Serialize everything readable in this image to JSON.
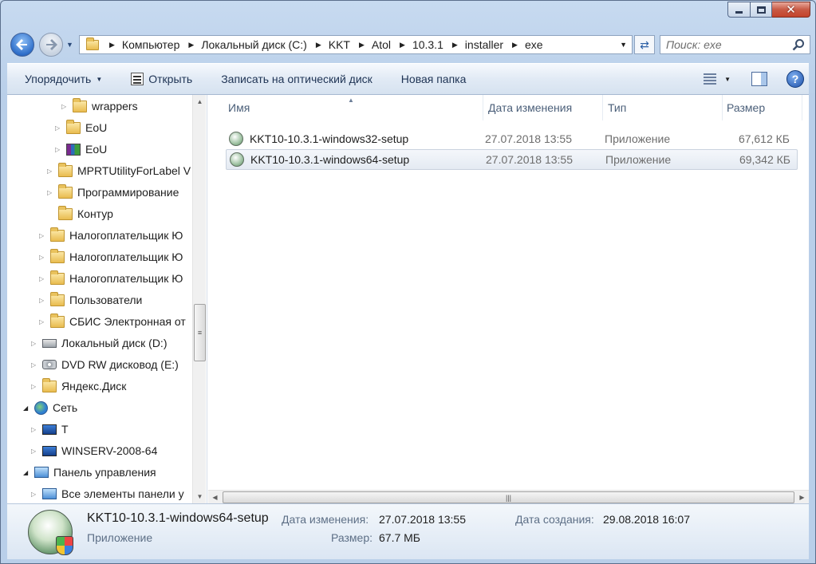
{
  "window": {
    "close_glyph": "✕"
  },
  "nav": {
    "breadcrumb": [
      "Компьютер",
      "Локальный диск (C:)",
      "KKT",
      "Atol",
      "10.3.1",
      "installer",
      "exe"
    ],
    "search_placeholder": "Поиск: exe",
    "refresh_glyph": "⇄"
  },
  "toolbar": {
    "organize": "Упорядочить",
    "open": "Открыть",
    "burn": "Записать на оптический диск",
    "new_folder": "Новая папка",
    "help": "?"
  },
  "tree": [
    {
      "label": "wrappers",
      "icon": "folder-icon",
      "expand": "collapsed"
    },
    {
      "label": "EoU",
      "icon": "folder-icon",
      "expand": "collapsed"
    },
    {
      "label": "EoU",
      "icon": "archive-icon",
      "expand": "collapsed"
    },
    {
      "label": "MPRTUtilityForLabel V",
      "icon": "folder-icon",
      "expand": "collapsed"
    },
    {
      "label": "Программирование",
      "icon": "folder-icon",
      "expand": "collapsed"
    },
    {
      "label": "Контур",
      "icon": "folder-icon",
      "expand": "none"
    },
    {
      "label": "Налогоплательщик Ю",
      "icon": "folder-icon",
      "expand": "collapsed"
    },
    {
      "label": "Налогоплательщик Ю",
      "icon": "folder-icon",
      "expand": "collapsed"
    },
    {
      "label": "Налогоплательщик Ю",
      "icon": "folder-icon",
      "expand": "collapsed"
    },
    {
      "label": "Пользователи",
      "icon": "folder-icon",
      "expand": "collapsed"
    },
    {
      "label": "СБИС Электронная от",
      "icon": "folder-icon",
      "expand": "collapsed"
    },
    {
      "label": "Локальный диск (D:)",
      "icon": "disk-icon",
      "expand": "collapsed"
    },
    {
      "label": "DVD RW дисковод (E:)",
      "icon": "dvd-icon",
      "expand": "collapsed"
    },
    {
      "label": "Яндекс.Диск",
      "icon": "folder-icon",
      "expand": "collapsed"
    },
    {
      "label": "Сеть",
      "icon": "network-icon",
      "expand": "open"
    },
    {
      "label": "T",
      "icon": "computer-icon",
      "expand": "collapsed"
    },
    {
      "label": "WINSERV-2008-64",
      "icon": "computer-icon",
      "expand": "collapsed"
    },
    {
      "label": "Панель управления",
      "icon": "control-panel-icon",
      "expand": "open"
    },
    {
      "label": "Все элементы панели у",
      "icon": "control-panel-icon",
      "expand": "collapsed"
    }
  ],
  "columns": {
    "name": "Имя",
    "date": "Дата изменения",
    "type": "Тип",
    "size": "Размер"
  },
  "files": [
    {
      "name": "KKT10-10.3.1-windows32-setup",
      "date": "27.07.2018 13:55",
      "type": "Приложение",
      "size": "67,612 КБ"
    },
    {
      "name": "KKT10-10.3.1-windows64-setup",
      "date": "27.07.2018 13:55",
      "type": "Приложение",
      "size": "69,342 КБ"
    }
  ],
  "details": {
    "name": "KKT10-10.3.1-windows64-setup",
    "type": "Приложение",
    "modified_label": "Дата изменения:",
    "modified_value": "27.07.2018 13:55",
    "size_label": "Размер:",
    "size_value": "67.7 МБ",
    "created_label": "Дата создания:",
    "created_value": "29.08.2018 16:07"
  }
}
